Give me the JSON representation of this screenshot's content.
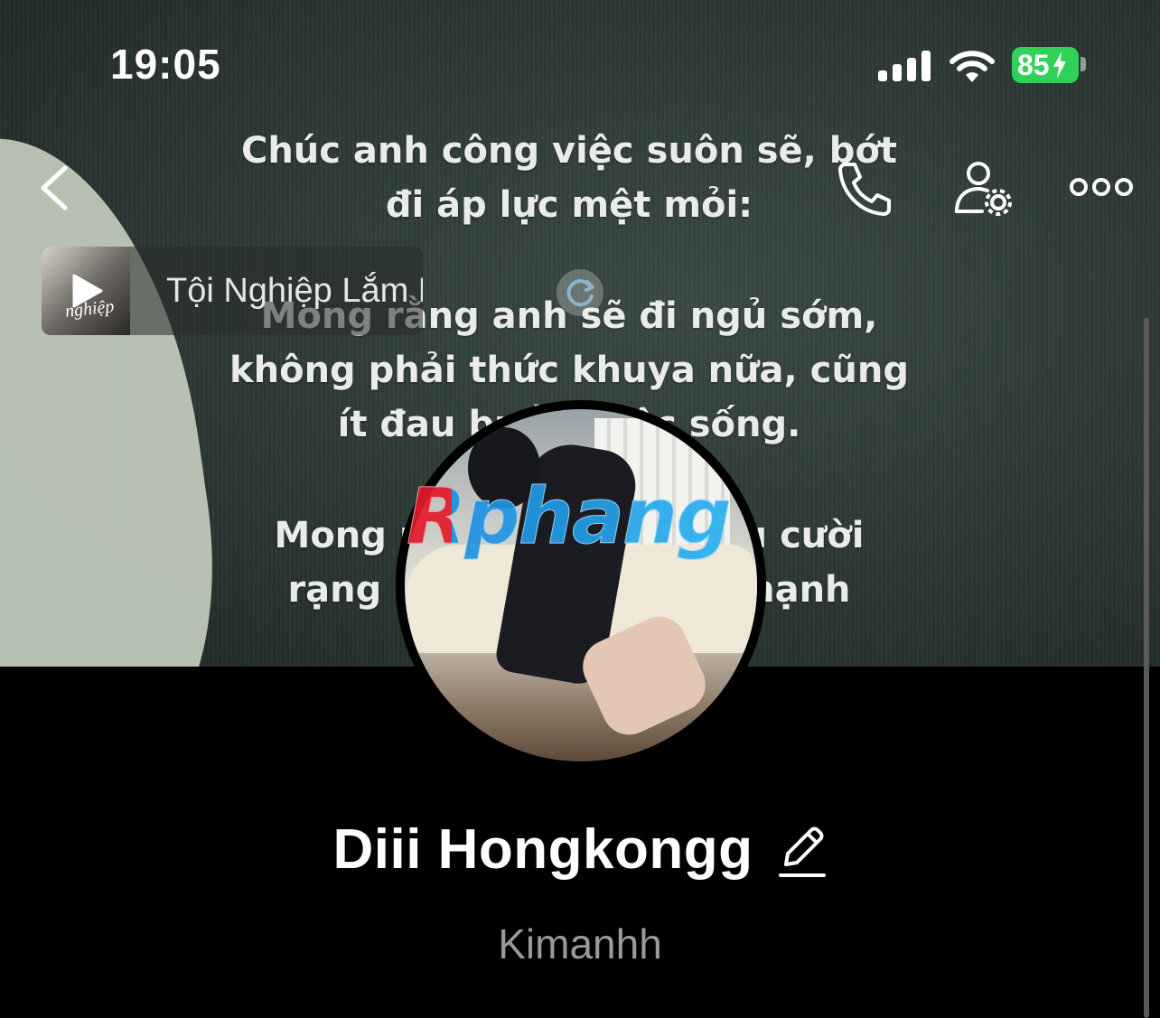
{
  "status_bar": {
    "time": "19:05",
    "battery": "85",
    "battery_color": "#30d158",
    "icons": [
      "signal-icon",
      "wifi-icon",
      "battery-charging-icon"
    ]
  },
  "nav": {
    "back_icon": "chevron-left-icon",
    "call_icon": "phone-icon",
    "profile_settings_icon": "user-gear-icon",
    "more_icon": "more-dots-icon"
  },
  "cover": {
    "text_1": "Chúc anh công việc suôn sẽ, bớt\nđi áp lực mệt mỏi:",
    "text_2": "Mong rằng anh sẽ đi ngủ sớm,\nkhông phải thức khuya nữa, cũng\nít đau buồn cuộc sống.",
    "text_3": "Mong rằng anh sẽ nở nụ cười\nrạng rỡ và hạnh phúc, hạnh"
  },
  "music": {
    "song_title": "Tội Nghiệp Lắm Em",
    "album_art_text": "nghiệp",
    "play_icon": "play-icon",
    "loading_icon": "loading-icon"
  },
  "watermark": "Rphang",
  "profile": {
    "name": "Diii Hongkongg",
    "username": "Kimanhh",
    "edit_icon": "pencil-icon"
  }
}
